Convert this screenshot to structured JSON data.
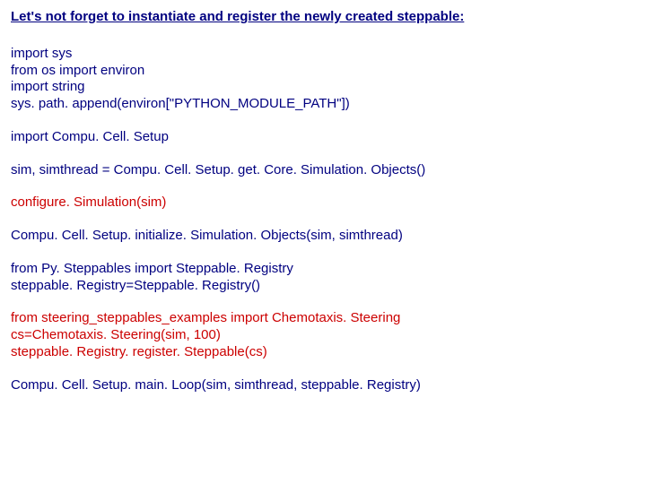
{
  "title": "Let's not forget to instantiate and register the newly created steppable:",
  "block1": {
    "l1": "import sys",
    "l2": "from os import environ",
    "l3": "import string",
    "l4": "sys. path. append(environ[\"PYTHON_MODULE_PATH\"])"
  },
  "block2": "import Compu. Cell. Setup",
  "block3": "sim, simthread = Compu. Cell. Setup. get. Core. Simulation. Objects()",
  "block4": "configure. Simulation(sim)",
  "block5": "Compu. Cell. Setup. initialize. Simulation. Objects(sim, simthread)",
  "block6": {
    "l1": "from Py. Steppables import Steppable. Registry",
    "l2": "steppable. Registry=Steppable. Registry()"
  },
  "block7": {
    "l1": "from steering_steppables_examples import Chemotaxis. Steering",
    "l2": "cs=Chemotaxis. Steering(sim, 100)",
    "l3": "steppable. Registry. register. Steppable(cs)"
  },
  "block8": "Compu. Cell. Setup. main. Loop(sim, simthread, steppable. Registry)"
}
